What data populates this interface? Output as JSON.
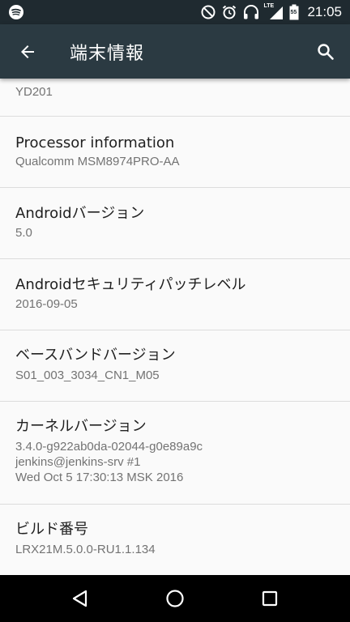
{
  "status_bar": {
    "time": "21:05",
    "icons": [
      "spotify-icon",
      "do-not-disturb-icon",
      "alarm-icon",
      "headphones-icon",
      "lte-signal-icon",
      "battery-icon"
    ],
    "lte_label": "LTE",
    "battery_level": "55"
  },
  "app_bar": {
    "title": "端末情報",
    "back_icon": "arrow-back-icon",
    "search_icon": "search-icon"
  },
  "items": [
    {
      "summary": "YD201"
    },
    {
      "title": "Processor information",
      "summary_lines": [
        "Qualcomm MSM8974PRO-AA"
      ]
    },
    {
      "title": "Androidバージョン",
      "summary_lines": [
        "5.0"
      ]
    },
    {
      "title": "Androidセキュリティパッチレベル",
      "summary_lines": [
        "2016-09-05"
      ]
    },
    {
      "title": "ベースバンドバージョン",
      "summary_lines": [
        "S01_003_3034_CN1_M05"
      ]
    },
    {
      "title": "カーネルバージョン",
      "summary_lines": [
        "3.4.0-g922ab0da-02044-g0e89a9c",
        "jenkins@jenkins-srv #1",
        "Wed Oct 5 17:30:13 MSK 2016"
      ]
    },
    {
      "title": "ビルド番号",
      "summary_lines": [
        "LRX21M.5.0.0-RU1.1.134"
      ]
    }
  ],
  "nav_bar": {
    "icons": [
      "back-triangle-icon",
      "home-circle-icon",
      "recents-square-icon"
    ]
  },
  "colors": {
    "status_bar": "#1f2a30",
    "app_bar": "#2b3a42",
    "background": "#fafafa",
    "divider": "#dcdcdc",
    "title_text": "#212121",
    "summary_text": "#737373"
  }
}
